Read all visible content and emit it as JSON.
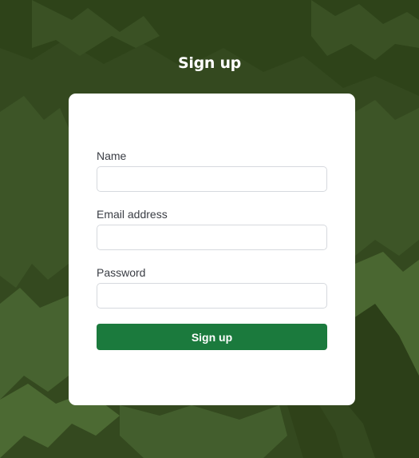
{
  "page": {
    "title": "Sign up"
  },
  "form": {
    "name_label": "Name",
    "name_value": "",
    "email_label": "Email address",
    "email_value": "",
    "password_label": "Password",
    "password_value": "",
    "submit_label": "Sign up"
  },
  "colors": {
    "background": "#34491f",
    "card": "#ffffff",
    "button": "#1b7a3d",
    "button_text": "#ffffff",
    "label_text": "#3a3d44",
    "input_border": "#d6d9de"
  }
}
